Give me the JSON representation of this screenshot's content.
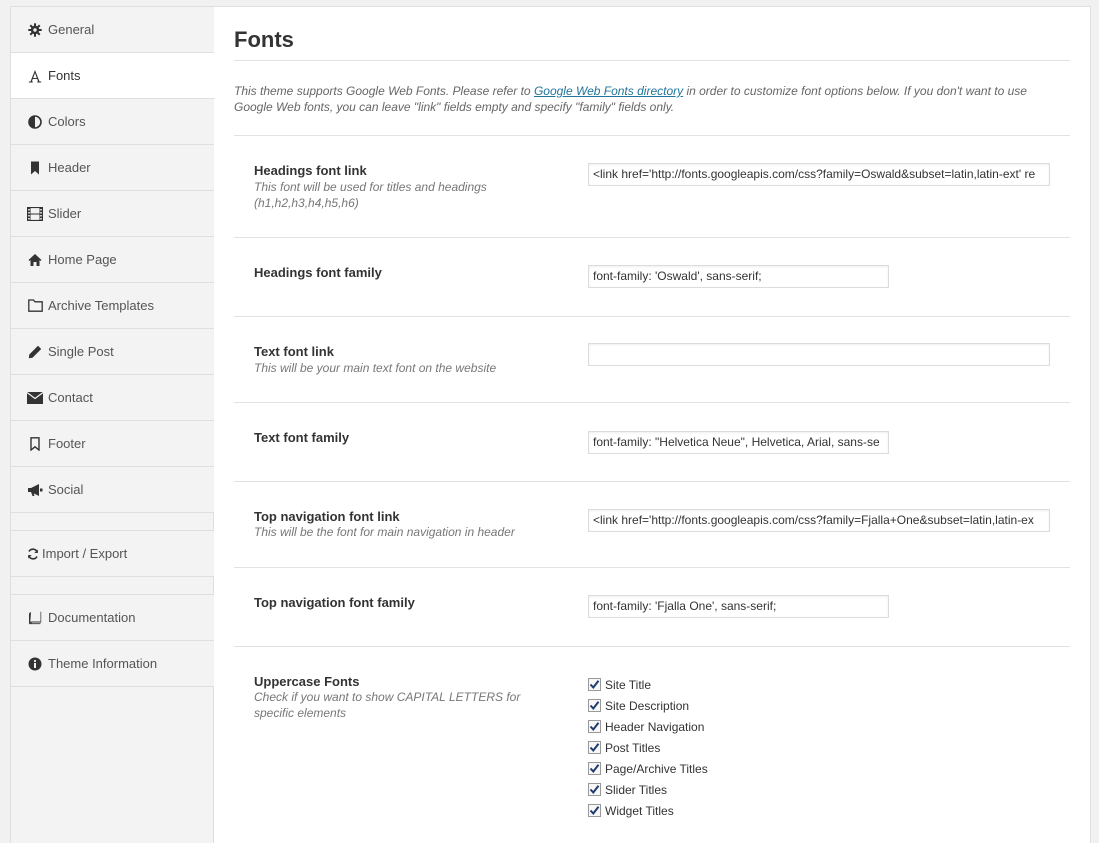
{
  "sidebar": {
    "items": [
      {
        "label": "General",
        "icon": "gear-icon"
      },
      {
        "label": "Fonts",
        "icon": "font-icon"
      },
      {
        "label": "Colors",
        "icon": "contrast-icon"
      },
      {
        "label": "Header",
        "icon": "bookmark-icon"
      },
      {
        "label": "Slider",
        "icon": "film-icon"
      },
      {
        "label": "Home Page",
        "icon": "home-icon"
      },
      {
        "label": "Archive Templates",
        "icon": "folder-icon"
      },
      {
        "label": "Single Post",
        "icon": "pencil-icon"
      },
      {
        "label": "Contact",
        "icon": "envelope-icon"
      },
      {
        "label": "Footer",
        "icon": "bookmark-outline-icon"
      },
      {
        "label": "Social",
        "icon": "megaphone-icon"
      }
    ],
    "import_export": {
      "label": "Import / Export",
      "icon": "refresh-icon"
    },
    "documentation": {
      "label": "Documentation",
      "icon": "book-icon"
    },
    "theme_information": {
      "label": "Theme Information",
      "icon": "info-icon"
    }
  },
  "main": {
    "title": "Fonts",
    "intro_before": "This theme supports Google Web Fonts. Please refer to ",
    "intro_link": "Google Web Fonts directory",
    "intro_after": " in order to customize font options below. If you don't want to use Google Web fonts, you can leave \"link\" fields empty and specify \"family\" fields only.",
    "headings_link": {
      "label": "Headings font link",
      "desc": "This font will be used for titles and headings (h1,h2,h3,h4,h5,h6)",
      "value": "<link href='http://fonts.googleapis.com/css?family=Oswald&subset=latin,latin-ext' re"
    },
    "headings_family": {
      "label": "Headings font family",
      "value": "font-family: 'Oswald', sans-serif;"
    },
    "text_link": {
      "label": "Text font link",
      "desc": "This will be your main text font on the website",
      "value": ""
    },
    "text_family": {
      "label": "Text font family",
      "value": "font-family: \"Helvetica Neue\", Helvetica, Arial, sans-se"
    },
    "nav_link": {
      "label": "Top navigation font link",
      "desc": "This will be the font for main navigation in header",
      "value": "<link href='http://fonts.googleapis.com/css?family=Fjalla+One&subset=latin,latin-ex"
    },
    "nav_family": {
      "label": "Top navigation font family",
      "value": "font-family: 'Fjalla One', sans-serif;"
    },
    "uppercase": {
      "label": "Uppercase Fonts",
      "desc": "Check if you want to show CAPITAL LETTERS for specific elements",
      "options": [
        {
          "label": "Site Title",
          "checked": true
        },
        {
          "label": "Site Description",
          "checked": true
        },
        {
          "label": "Header Navigation",
          "checked": true
        },
        {
          "label": "Post Titles",
          "checked": true
        },
        {
          "label": "Page/Archive Titles",
          "checked": true
        },
        {
          "label": "Slider Titles",
          "checked": true
        },
        {
          "label": "Widget Titles",
          "checked": true
        }
      ]
    }
  }
}
